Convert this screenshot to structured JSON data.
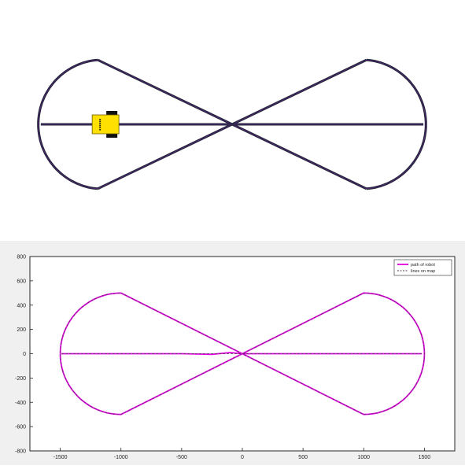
{
  "map": {
    "track_color": "#1c2833",
    "overlay_color": "#7b1fa2",
    "robot_body_color": "#ffe000",
    "wheel_color": "#111111"
  },
  "chart_data": {
    "type": "line",
    "title": "",
    "xlabel": "",
    "ylabel": "",
    "xlim": [
      -1750,
      1750
    ],
    "ylim": [
      -800,
      800
    ],
    "xticks": [
      -1500,
      -1000,
      -500,
      0,
      500,
      1000,
      1500
    ],
    "yticks": [
      -800,
      -600,
      -400,
      -200,
      0,
      200,
      400,
      600,
      800
    ],
    "grid": false,
    "legend_position": "top-right",
    "series": [
      {
        "name": "path of robot",
        "color": "#e600e6",
        "style": "solid",
        "x": [
          -1490,
          -1000,
          -500,
          -250,
          -100,
          0,
          250,
          500,
          1000,
          1480
        ],
        "y": [
          0,
          0,
          0,
          -5,
          10,
          0,
          0,
          0,
          0,
          0
        ]
      },
      {
        "name": "lines on map",
        "color": "#444444",
        "style": "dashed",
        "x": [
          -1490,
          0,
          1490
        ],
        "y": [
          0,
          0,
          0
        ]
      }
    ],
    "shapes": {
      "lobe_tip_x": [
        -1000,
        1000
      ],
      "lobe_tip_y": [
        500,
        -500
      ],
      "outer_x": [
        -1500,
        1500
      ],
      "crossing": [
        0,
        0
      ]
    }
  }
}
